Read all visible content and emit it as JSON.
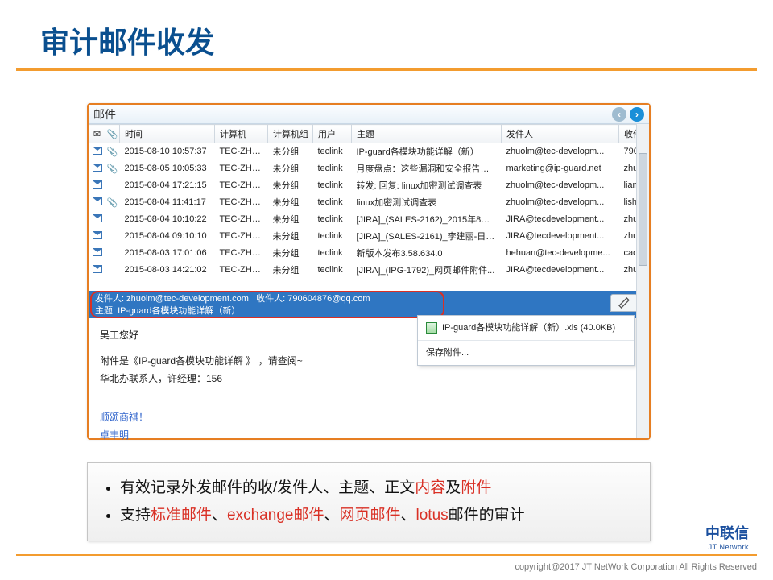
{
  "title": "审计邮件收发",
  "window": {
    "title": "邮件"
  },
  "columns": {
    "time": "时间",
    "computer": "计算机",
    "group": "计算机组",
    "user": "用户",
    "subject": "主题",
    "sender": "发件人",
    "recipient": "收件人"
  },
  "rows": [
    {
      "time": "2015-08-10 10:57:37",
      "computer": "TEC-ZHU...",
      "group": "未分组",
      "user": "teclink",
      "subject": "IP-guard各模块功能详解（新）",
      "sender": "zhuolm@tec-developm...",
      "recipient": "790"
    },
    {
      "time": "2015-08-05 10:05:33",
      "computer": "TEC-ZHU...",
      "group": "未分组",
      "user": "teclink",
      "subject": "月度盘点：这些漏洞和安全报告看...",
      "sender": "marketing@ip-guard.net",
      "recipient": "zhu"
    },
    {
      "time": "2015-08-04 17:21:15",
      "computer": "TEC-ZHU...",
      "group": "未分组",
      "user": "teclink",
      "subject": "转发: 回复: linux加密测试调查表",
      "sender": "zhuolm@tec-developm...",
      "recipient": "lian"
    },
    {
      "time": "2015-08-04 11:41:17",
      "computer": "TEC-ZHU...",
      "group": "未分组",
      "user": "teclink",
      "subject": "linux加密测试调查表",
      "sender": "zhuolm@tec-developm...",
      "recipient": "lish"
    },
    {
      "time": "2015-08-04 10:10:22",
      "computer": "TEC-ZHU...",
      "group": "未分组",
      "user": "teclink",
      "subject": "[JIRA]_(SALES-2162)_2015年8月4...",
      "sender": "JIRA@tecdevelopment...",
      "recipient": "zhu"
    },
    {
      "time": "2015-08-04 09:10:10",
      "computer": "TEC-ZHU...",
      "group": "未分组",
      "user": "teclink",
      "subject": "[JIRA]_(SALES-2161)_李建丽-日东...",
      "sender": "JIRA@tecdevelopment...",
      "recipient": "zhu"
    },
    {
      "time": "2015-08-03 17:01:06",
      "computer": "TEC-ZHU...",
      "group": "未分组",
      "user": "teclink",
      "subject": "新版本发布3.58.634.0",
      "sender": "hehuan@tec-developme...",
      "recipient": "cao"
    },
    {
      "time": "2015-08-03 14:21:02",
      "computer": "TEC-ZHU...",
      "group": "未分组",
      "user": "teclink",
      "subject": "[JIRA]_(IPG-1792)_网页邮件附件...",
      "sender": "JIRA@tecdevelopment...",
      "recipient": "zhu"
    }
  ],
  "detail": {
    "sender_label": "发件人:",
    "sender": "zhuolm@tec-development.com",
    "recipient_label": "收件人:",
    "recipient": "790604876@qq.com",
    "subject_label": "主题:",
    "subject": "IP-guard各模块功能详解（新）",
    "greeting": "吴工您好",
    "body_line1": "附件是《IP-guard各模块功能详解 》 ，请查阅~",
    "body_line2": "华北办联系人，许经理：156",
    "sign1": "顺颂商祺！",
    "sign2": "卓丰明"
  },
  "attachment": {
    "file": "IP-guard各模块功能详解（新）.xls (40.0KB)",
    "save": "保存附件..."
  },
  "bullets": {
    "l1a": "有效记录外发邮件的收/发件人、主题、正文",
    "l1b": "内容",
    "l1c": "及",
    "l1d": "附件",
    "l2a": "支持",
    "l2b": "标准邮件",
    "l2c": "、",
    "l2d": "exchange邮件",
    "l2e": "、",
    "l2f": "网页邮件",
    "l2g": "、",
    "l2h": "lotus",
    "l2i": "邮件的审计"
  },
  "logo": {
    "cn": "中联信",
    "en": "JT Network"
  },
  "copyright": "copyright@2017  JT NetWork Corporation All Rights Reserved"
}
